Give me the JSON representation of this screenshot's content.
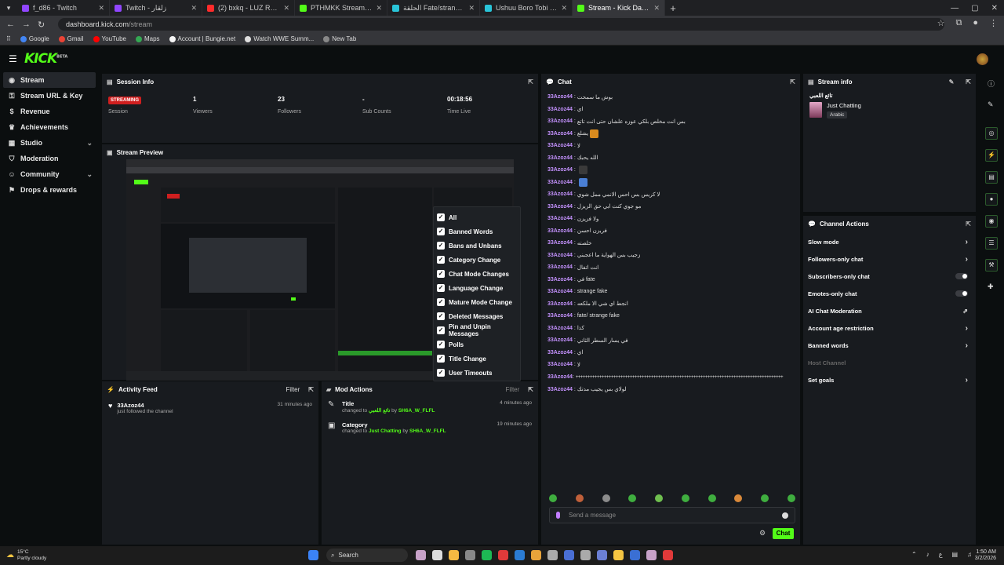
{
  "browser": {
    "tabs": [
      {
        "label": "f_d86 - Twitch",
        "color": "#9146ff",
        "active": false
      },
      {
        "label": "Twitch - زلقار",
        "color": "#9146ff",
        "active": false
      },
      {
        "label": "(2) bxkq - LUZ ROJA - Slowed",
        "color": "#ff2b2b",
        "active": false
      },
      {
        "label": "PTHMKK Stream - Watch Live on",
        "color": "#53fc18",
        "active": false
      },
      {
        "label": "الحلقة Fate/strange Fake الذهبي",
        "color": "#29c4d8",
        "active": false
      },
      {
        "label": "Ushuu Boro Tobi - gumi الذهبي",
        "color": "#29c4d8",
        "active": false
      },
      {
        "label": "Stream - Kick Dashboard",
        "color": "#53fc18",
        "active": true
      }
    ],
    "url_host": "dashboard.kick.com",
    "url_path": "/stream",
    "bookmarks": [
      "Google",
      "Gmail",
      "YouTube",
      "Maps",
      "Account | Bungie.net",
      "Watch WWE Summ...",
      "New Tab"
    ]
  },
  "app": {
    "logo": "KICK",
    "logo_badge": "BETA"
  },
  "sidebar": {
    "items": [
      {
        "label": "Stream",
        "icon": "broadcast-icon"
      },
      {
        "label": "Stream URL & Key",
        "icon": "key-icon"
      },
      {
        "label": "Revenue",
        "icon": "dollar-icon"
      },
      {
        "label": "Achievements",
        "icon": "trophy-icon"
      },
      {
        "label": "Studio",
        "icon": "studio-icon"
      },
      {
        "label": "Moderation",
        "icon": "shield-icon"
      },
      {
        "label": "Community",
        "icon": "community-icon"
      },
      {
        "label": "Drops & rewards",
        "icon": "gift-icon"
      }
    ]
  },
  "session": {
    "title": "Session Info",
    "status": "STREAMING",
    "session_label": "Session",
    "viewers": "1",
    "viewers_label": "Viewers",
    "followers": "23",
    "followers_label": "Followers",
    "subs": "-",
    "subs_label": "Sub Counts",
    "time": "00:18:56",
    "time_label": "Time Live"
  },
  "preview": {
    "title": "Stream Preview"
  },
  "filter_menu": {
    "options": [
      "All",
      "Banned Words",
      "Bans and Unbans",
      "Category Change",
      "Chat Mode Changes",
      "Language Change",
      "Mature Mode Change",
      "Deleted Messages",
      "Pin and Unpin Messages",
      "Polls",
      "Title Change",
      "User Timeouts"
    ]
  },
  "activity": {
    "title": "Activity Feed",
    "filter": "Filter",
    "items": [
      {
        "user": "33Azoz44",
        "text": "just followed the channel",
        "time": "31 minutes ago"
      }
    ]
  },
  "mod_actions": {
    "title": "Mod Actions",
    "filter": "Filter",
    "items": [
      {
        "type": "Title",
        "prefix": "changed to",
        "value": "تائع اللعبي",
        "by": "by",
        "mod": "SH6A_W_FLFL",
        "time": "4 minutes ago"
      },
      {
        "type": "Category",
        "prefix": "changed to",
        "value": "Just Chatting",
        "by": "by",
        "mod": "SH6A_W_FLFL",
        "time": "19 minutes ago"
      }
    ]
  },
  "chat": {
    "title": "Chat",
    "user": "33Azoz44",
    "messages": [
      "بوش ما سمحت",
      "اي",
      "بس انت مخلص بلكي عوزه علشان حتى انت تاتع",
      "يشلع",
      "لا",
      "الله يحبك",
      "",
      "",
      "لا كريس بس احس الانمي ممل شوي",
      "مو جوي كنت ابي حق الزيزل",
      "ولا فزيزن",
      "فريزن احسن",
      "خلصته",
      "زجيب بس الهواية ما اعجبني",
      "انت اتفال",
      "في fate",
      "strange fake",
      "انجط اي شي الا ملكعه",
      "fate/ strange fake",
      "كذا",
      "في يسار السطر الثاني",
      "اي",
      "لا",
      "++++++++++++++++++++++++++++++++++++++++++++++++++++++++++++++++++++++++++++++++++++++++",
      "لولاي بس يجيب مدتك"
    ],
    "input_placeholder": "Send a message",
    "send_label": "Chat"
  },
  "stream_info": {
    "title": "Stream info",
    "stream_title": "تائع اللعبي",
    "category": "Just Chatting",
    "language": "Arabic"
  },
  "channel_actions": {
    "title": "Channel Actions",
    "items": [
      {
        "label": "Slow mode",
        "control": "chevron"
      },
      {
        "label": "Followers-only chat",
        "control": "chevron"
      },
      {
        "label": "Subscribers-only chat",
        "control": "toggle"
      },
      {
        "label": "Emotes-only chat",
        "control": "toggle"
      },
      {
        "label": "AI Chat Moderation",
        "control": "external"
      },
      {
        "label": "Account age restriction",
        "control": "chevron"
      },
      {
        "label": "Banned words",
        "control": "chevron"
      },
      {
        "label": "Host Channel",
        "control": "none"
      },
      {
        "label": "Set goals",
        "control": "chevron"
      }
    ]
  },
  "taskbar": {
    "weather_temp": "15°C",
    "weather_desc": "Partly cloudy",
    "search": "Search",
    "time": "1:50 AM",
    "date": "3/2/2026"
  }
}
